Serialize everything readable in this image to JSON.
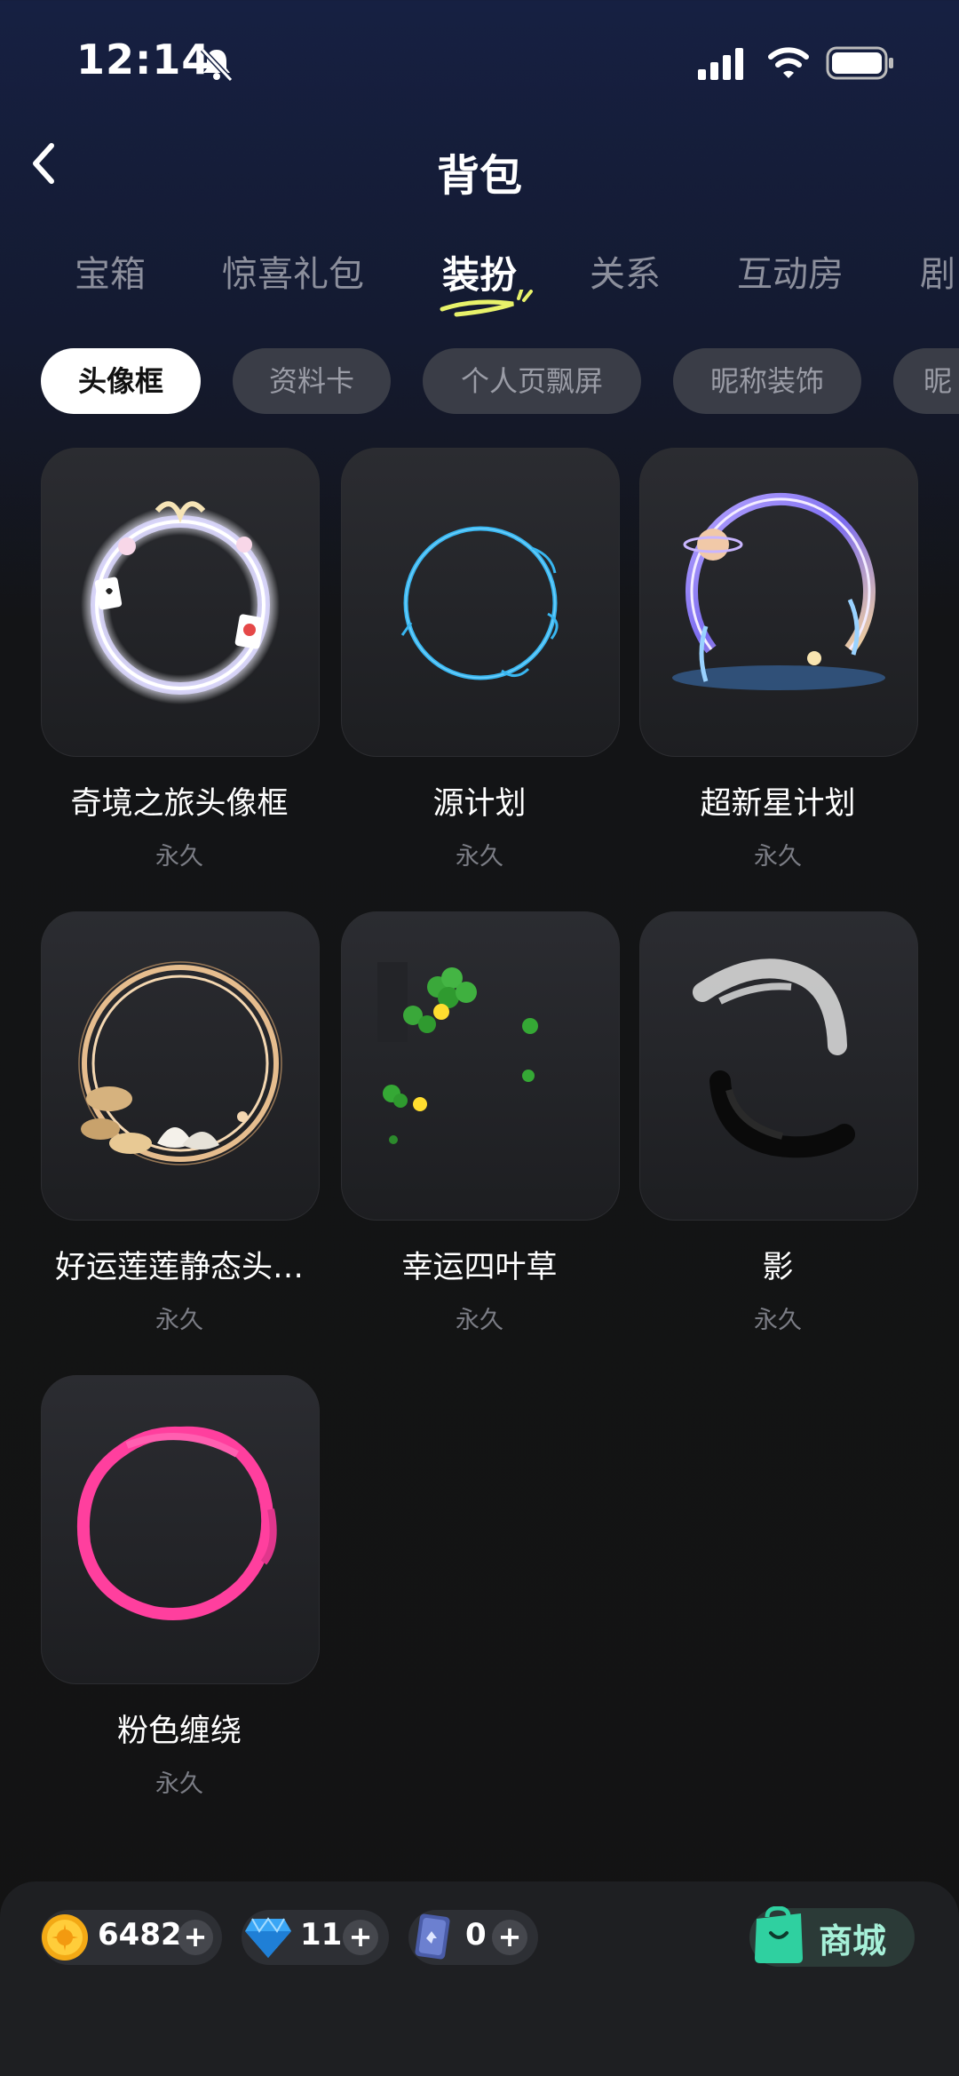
{
  "status": {
    "time": "12:14"
  },
  "header": {
    "title": "背包"
  },
  "tabs": [
    "宝箱",
    "惊喜礼包",
    "装扮",
    "关系",
    "互动房",
    "剧"
  ],
  "chips": [
    "头像框",
    "资料卡",
    "个人页飘屏",
    "昵称装饰",
    "昵"
  ],
  "items": [
    {
      "name": "奇境之旅头像框",
      "duration": "永久",
      "icon": "wonderland-frame-icon"
    },
    {
      "name": "源计划",
      "duration": "永久",
      "icon": "blue-ring-frame-icon"
    },
    {
      "name": "超新星计划",
      "duration": "永久",
      "icon": "supernova-frame-icon"
    },
    {
      "name": "好运莲莲静态头…",
      "duration": "永久",
      "icon": "lotus-frame-icon"
    },
    {
      "name": "幸运四叶草",
      "duration": "永久",
      "icon": "clover-frame-icon"
    },
    {
      "name": "影",
      "duration": "永久",
      "icon": "ink-shadow-frame-icon"
    },
    {
      "name": "粉色缠绕",
      "duration": "永久",
      "icon": "pink-loop-frame-icon"
    }
  ],
  "currencies": [
    {
      "value": "6482",
      "icon": "gold-coin-icon"
    },
    {
      "value": "11",
      "icon": "diamond-icon"
    },
    {
      "value": "0",
      "icon": "card-ticket-icon"
    }
  ],
  "shop": {
    "label": "商城"
  },
  "colors": {
    "accent_underline": "#e8f26a",
    "pink_frame": "#ff3f9e",
    "blue_frame": "#38b6f0"
  }
}
